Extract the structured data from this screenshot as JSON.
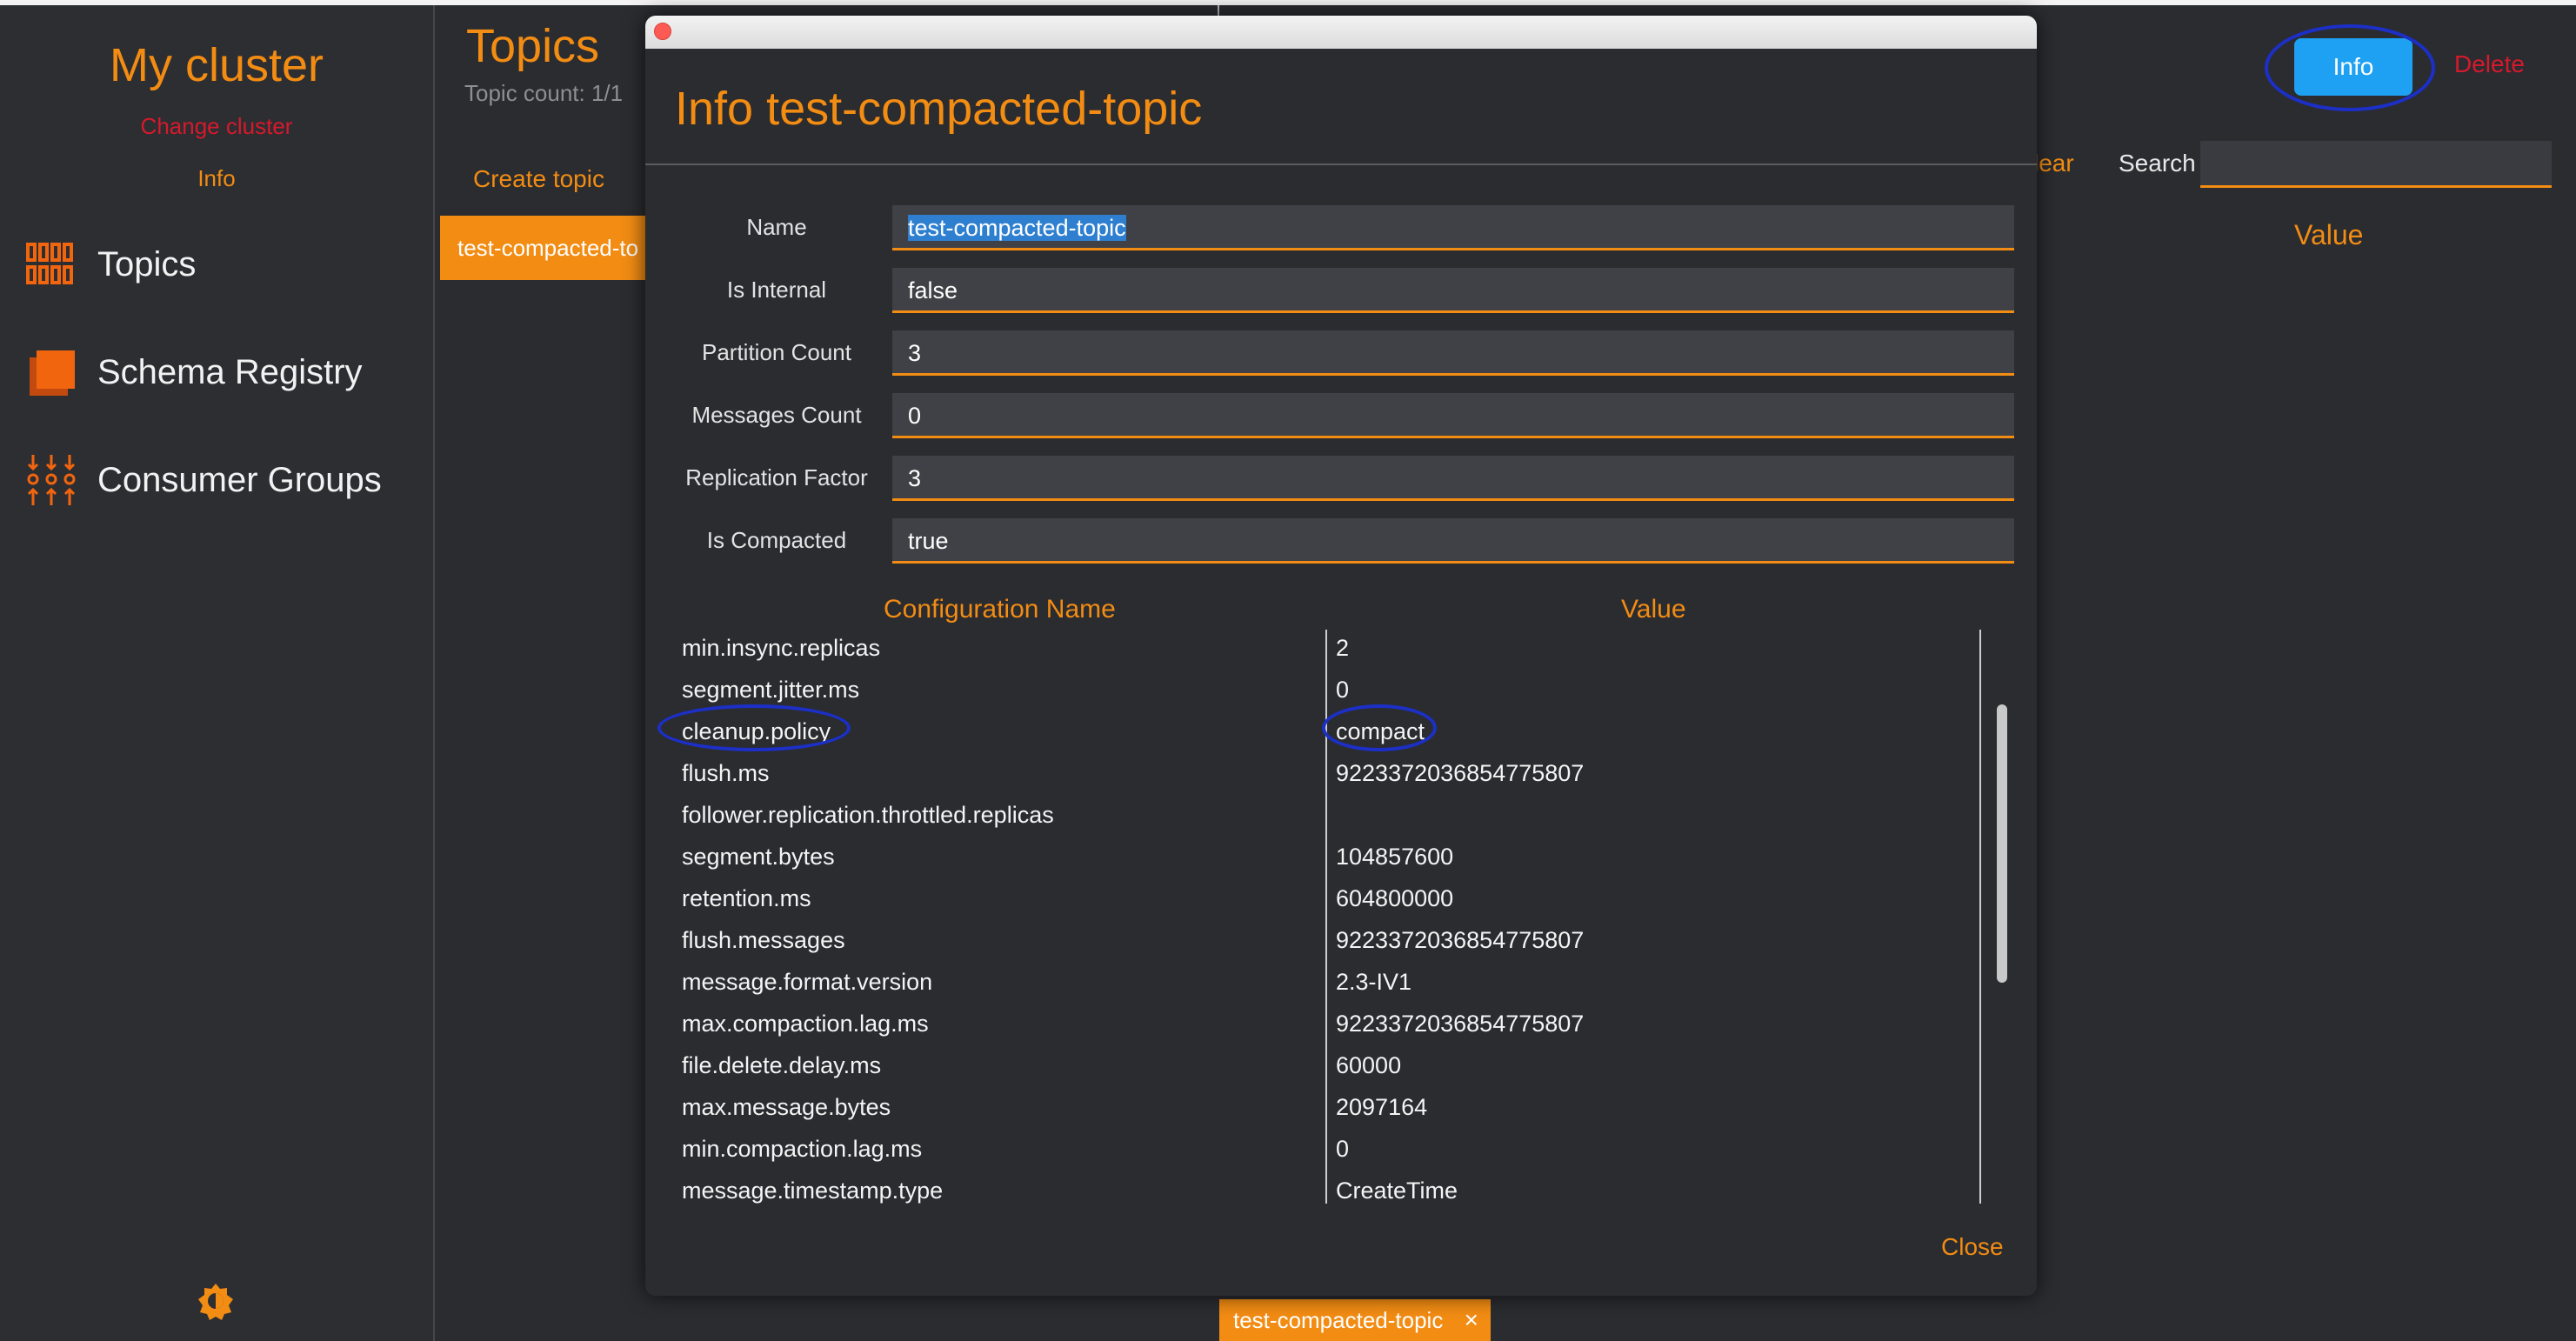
{
  "sidebar": {
    "cluster_title": "My cluster",
    "change_cluster": "Change cluster",
    "info": "Info",
    "items": [
      {
        "label": "Topics",
        "icon": "topics-icon"
      },
      {
        "label": "Schema Registry",
        "icon": "schema-registry-icon"
      },
      {
        "label": "Consumer Groups",
        "icon": "consumer-groups-icon"
      }
    ],
    "theme_icon": "theme-toggle-icon"
  },
  "topics_panel": {
    "title": "Topics",
    "count": "Topic count: 1/1",
    "create": "Create topic",
    "items": [
      "test-compacted-to"
    ]
  },
  "header": {
    "info_label": "Info",
    "delete_label": "Delete",
    "clear_label": "lear",
    "search_label": "Search",
    "search_value": "",
    "value_header": "Value"
  },
  "bottom_tab": {
    "label": "test-compacted-topic",
    "close": "×"
  },
  "modal": {
    "title": "Info test-compacted-topic",
    "fields": [
      {
        "label": "Name",
        "value": "test-compacted-topic"
      },
      {
        "label": "Is Internal",
        "value": "false"
      },
      {
        "label": "Partition Count",
        "value": "3"
      },
      {
        "label": "Messages Count",
        "value": "0"
      },
      {
        "label": "Replication Factor",
        "value": "3"
      },
      {
        "label": "Is Compacted",
        "value": "true"
      }
    ],
    "config_header_name": "Configuration Name",
    "config_header_value": "Value",
    "configs": [
      {
        "name": "min.insync.replicas",
        "value": "2"
      },
      {
        "name": "segment.jitter.ms",
        "value": "0"
      },
      {
        "name": "cleanup.policy",
        "value": "compact"
      },
      {
        "name": "flush.ms",
        "value": "9223372036854775807"
      },
      {
        "name": "follower.replication.throttled.replicas",
        "value": ""
      },
      {
        "name": "segment.bytes",
        "value": "104857600"
      },
      {
        "name": "retention.ms",
        "value": "604800000"
      },
      {
        "name": "flush.messages",
        "value": "9223372036854775807"
      },
      {
        "name": "message.format.version",
        "value": "2.3-IV1"
      },
      {
        "name": "max.compaction.lag.ms",
        "value": "9223372036854775807"
      },
      {
        "name": "file.delete.delay.ms",
        "value": "60000"
      },
      {
        "name": "max.message.bytes",
        "value": "2097164"
      },
      {
        "name": "min.compaction.lag.ms",
        "value": "0"
      },
      {
        "name": "message.timestamp.type",
        "value": "CreateTime"
      }
    ],
    "close_label": "Close"
  },
  "colors": {
    "accent": "#f28c13",
    "danger": "#d6192c",
    "primary": "#1ea1f2",
    "annotation": "#1c2fc7"
  }
}
